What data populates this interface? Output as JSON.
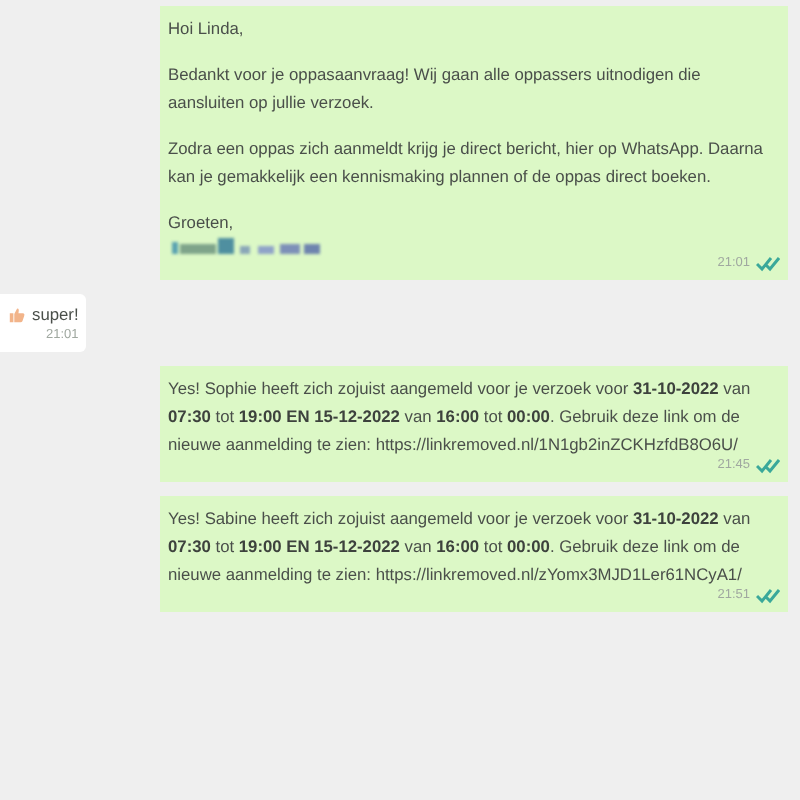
{
  "messages": [
    {
      "kind": "outgoing",
      "paragraphs": [
        "Hoi Linda,",
        "Bedankt voor je oppasaanvraag! Wij gaan alle oppassers uitnodigen die aansluiten op jullie verzoek.",
        "Zodra een oppas zich aanmeldt krijg je direct bericht, hier op WhatsApp. Daarna kan je gemakkelijk een kennismaking plannen of de oppas direct boeken.",
        "Groeten,"
      ],
      "redacted_signature": true,
      "time": "21:01",
      "read": true
    },
    {
      "kind": "incoming",
      "paragraphs": [
        "super!"
      ],
      "thumbs_up": true,
      "time": "21:01"
    },
    {
      "kind": "outgoing",
      "paragraphs": [
        "Yes! Sophie heeft zich zojuist aangemeld voor je verzoek voor **31-10-2022** van **07:30** tot **19:00 EN 15-12-2022** van **16:00** tot **00:00**. Gebruik deze link om de nieuwe aanmelding te zien: https://linkremoved.nl/1N1gb2inZCKHzfdB8O6U/"
      ],
      "time": "21:45",
      "read": true
    },
    {
      "kind": "outgoing",
      "paragraphs": [
        "Yes! Sabine heeft zich zojuist aangemeld voor je verzoek voor **31-10-2022** van **07:30** tot **19:00 EN 15-12-2022** van **16:00** tot **00:00**. Gebruik deze link om de nieuwe aanmelding te zien: https://linkremoved.nl/zYomx3MJD1Ler61NCyA1/"
      ],
      "time": "21:51",
      "read": true
    }
  ]
}
